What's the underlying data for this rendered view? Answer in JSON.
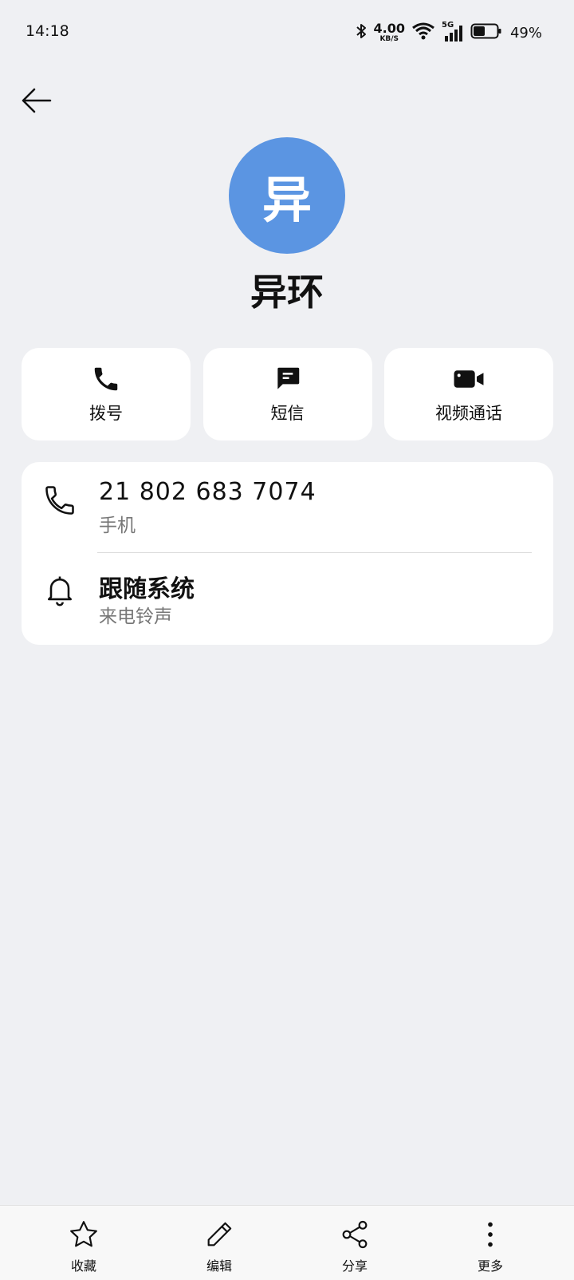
{
  "status_bar": {
    "time": "14:18",
    "network_speed": "4.00",
    "network_unit": "KB/S",
    "signal_type": "5G",
    "battery_percent": "49%",
    "battery_level": 0.49
  },
  "contact": {
    "avatar_letter": "异",
    "avatar_color": "#5b95e2",
    "name": "异环"
  },
  "actions": [
    {
      "label": "拨号",
      "icon": "phone-icon"
    },
    {
      "label": "短信",
      "icon": "message-icon"
    },
    {
      "label": "视频通话",
      "icon": "video-call-icon"
    }
  ],
  "details": {
    "phone_number": "21 802 683 7074",
    "phone_type": "手机",
    "ringtone": "跟随系统",
    "ringtone_label": "来电铃声"
  },
  "bottom_nav": [
    {
      "label": "收藏",
      "icon": "star-icon"
    },
    {
      "label": "编辑",
      "icon": "pencil-icon"
    },
    {
      "label": "分享",
      "icon": "share-icon"
    },
    {
      "label": "更多",
      "icon": "more-vertical-icon"
    }
  ]
}
